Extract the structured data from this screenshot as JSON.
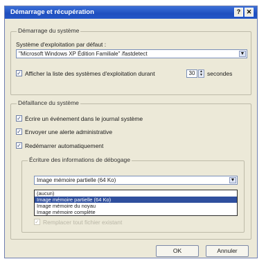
{
  "window": {
    "title": "Démarrage et récupération",
    "help_label": "?",
    "close_label": "✕"
  },
  "startup": {
    "group_label": "Démarrage du système",
    "default_os_label": "Système d'exploitation par défaut :",
    "default_os_value": "\"Microsoft Windows XP Édition Familiale\" /fastdetect",
    "show_list_label": "Afficher la liste des systèmes d'exploitation durant",
    "show_list_checked": true,
    "seconds_value": "30",
    "seconds_unit": "secondes"
  },
  "failure": {
    "group_label": "Défaillance du système",
    "options": [
      {
        "label": "Écrire un événement dans le journal système",
        "checked": true
      },
      {
        "label": "Envoyer une alerte administrative",
        "checked": true
      },
      {
        "label": "Redémarrer automatiquement",
        "checked": true
      }
    ]
  },
  "debug": {
    "group_label": "Écriture des informations de débogage",
    "selected_value": "Image mémoire partielle (64 Ko)",
    "dropdown_items": [
      {
        "label": "(aucun)",
        "selected": false
      },
      {
        "label": "Image mémoire partielle (64 Ko)",
        "selected": true
      },
      {
        "label": "Image mémoire du noyau",
        "selected": false
      },
      {
        "label": "Image mémoire complète",
        "selected": false
      }
    ],
    "faded_option_label": "Remplacer tout fichier existant"
  },
  "buttons": {
    "ok_label": "OK",
    "cancel_label": "Annuler"
  },
  "colors": {
    "titlebar": "#2456c8",
    "dialog_bg": "#ece9d8",
    "selection": "#2f4f9e"
  }
}
